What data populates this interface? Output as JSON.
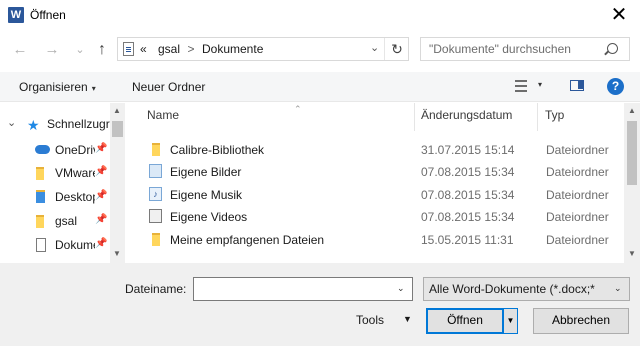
{
  "window": {
    "app_icon_letter": "W",
    "title": "Öffnen",
    "close_glyph": "✕"
  },
  "nav": {
    "back_glyph": "←",
    "forward_glyph": "→",
    "recent_glyph": "⌄",
    "up_glyph": "↑"
  },
  "address": {
    "overflow": "«",
    "crumbs": [
      "gsal",
      "Dokumente"
    ],
    "separator": ">",
    "dropdown_glyph": "⌄",
    "refresh_glyph": "↻"
  },
  "search": {
    "placeholder": "\"Dokumente\" durchsuchen"
  },
  "toolbar": {
    "organize_label": "Organisieren",
    "new_folder_label": "Neuer Ordner",
    "caret": "▾",
    "help_glyph": "?"
  },
  "sidebar": {
    "expand_glyph": "⌄",
    "quick_access_label": "Schnellzugriff",
    "pin_glyph": "📌",
    "items": [
      {
        "label": "OneDrive",
        "icon": "onedrive-icon"
      },
      {
        "label": "VMware",
        "icon": "folder-icon"
      },
      {
        "label": "Desktop",
        "icon": "desktop-folder-icon"
      },
      {
        "label": "gsal",
        "icon": "folder-icon"
      },
      {
        "label": "Dokumente",
        "icon": "documents-folder-icon"
      }
    ]
  },
  "file_list": {
    "columns": {
      "name": "Name",
      "date": "Änderungsdatum",
      "type": "Typ"
    },
    "rows": [
      {
        "name": "Calibre-Bibliothek",
        "date": "31.07.2015 15:14",
        "type": "Dateiordner",
        "icon": "folder-icon"
      },
      {
        "name": "Eigene Bilder",
        "date": "07.08.2015 15:34",
        "type": "Dateiordner",
        "icon": "pictures-shortcut-icon"
      },
      {
        "name": "Eigene Musik",
        "date": "07.08.2015 15:34",
        "type": "Dateiordner",
        "icon": "music-shortcut-icon"
      },
      {
        "name": "Eigene Videos",
        "date": "07.08.2015 15:34",
        "type": "Dateiordner",
        "icon": "videos-shortcut-icon"
      },
      {
        "name": "Meine empfangenen Dateien",
        "date": "15.05.2015 11:31",
        "type": "Dateiordner",
        "icon": "folder-icon"
      }
    ]
  },
  "footer": {
    "filename_label": "Dateiname:",
    "filename_value": "",
    "filetype_value": "Alle Word-Dokumente (*.docx;*",
    "tools_label": "Tools",
    "open_label": "Öffnen",
    "cancel_label": "Abbrechen"
  },
  "colors": {
    "accent": "#0078d7",
    "word_brand": "#2b579a",
    "folder": "#ffd65c",
    "help": "#1c6fc9"
  }
}
